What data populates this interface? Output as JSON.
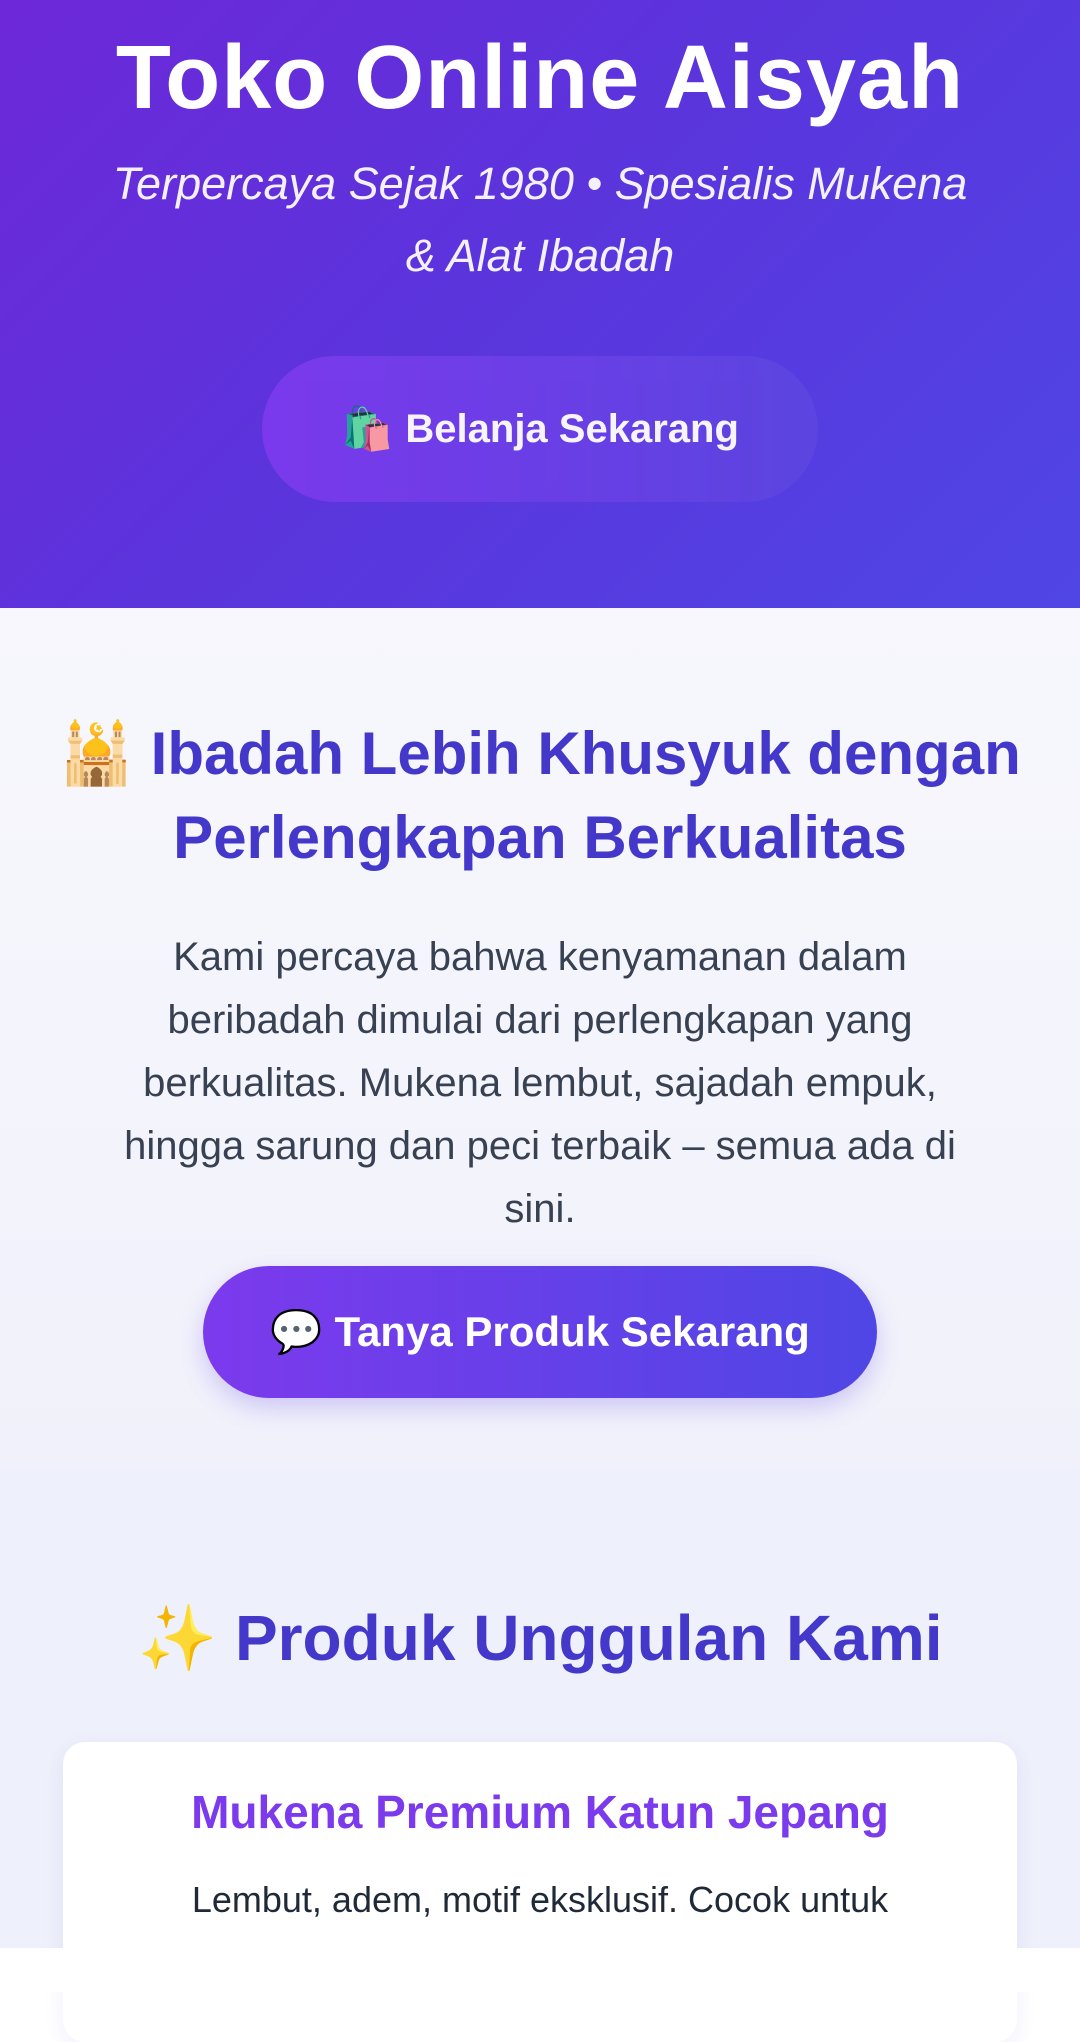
{
  "hero": {
    "title": "Toko Online Aisyah",
    "subtitle": "Terpercaya Sejak 1980 • Spesialis Mukena & Alat Ibadah",
    "shop_button": {
      "emoji": "🛍️",
      "label": "Belanja Sekarang"
    }
  },
  "intro": {
    "title": "🕌 Ibadah Lebih Khusyuk dengan Perlengkapan Berkualitas",
    "text": "Kami percaya bahwa kenyamanan dalam beribadah dimulai dari perlengkapan yang berkualitas. Mukena lembut, sajadah empuk, hingga sarung dan peci terbaik – semua ada di sini.",
    "ask_button": {
      "emoji": "💬",
      "label": "Tanya Produk Sekarang"
    }
  },
  "products": {
    "title": "✨ Produk Unggulan Kami",
    "items": [
      {
        "name": "Mukena Premium Katun Jepang",
        "description": "Lembut, adem, motif eksklusif. Cocok untuk"
      }
    ]
  },
  "colors": {
    "brand_purple": "#6d28d9",
    "brand_indigo": "#4f46e5",
    "heading": "#4338ca",
    "product_title": "#7c3aed"
  }
}
